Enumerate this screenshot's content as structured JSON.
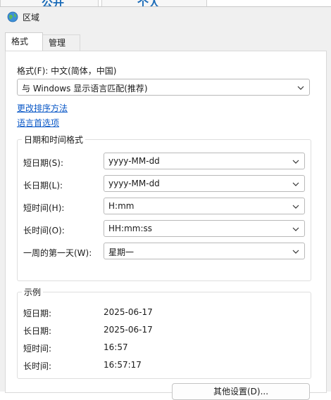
{
  "background": {
    "text_left": "公开",
    "text_right": "个人"
  },
  "window": {
    "title": "区域",
    "icon": "globe-icon"
  },
  "tabs": [
    {
      "label": "格式",
      "active": true
    },
    {
      "label": "管理",
      "active": false
    }
  ],
  "format": {
    "label": "格式(F): 中文(简体，中国)",
    "selected": "与 Windows 显示语言匹配(推荐)"
  },
  "links": {
    "sort": "更改排序方法",
    "language_prefs": "语言首选项"
  },
  "datetime_group": {
    "title": "日期和时间格式",
    "rows": [
      {
        "label": "短日期(S):",
        "value": "yyyy-MM-dd"
      },
      {
        "label": "长日期(L):",
        "value": "yyyy-MM-dd"
      },
      {
        "label": "短时间(H):",
        "value": "H:mm"
      },
      {
        "label": "长时间(O):",
        "value": "HH:mm:ss"
      },
      {
        "label": "一周的第一天(W):",
        "value": "星期一"
      }
    ]
  },
  "examples_group": {
    "title": "示例",
    "rows": [
      {
        "label": "短日期:",
        "value": "2025-06-17"
      },
      {
        "label": "长日期:",
        "value": "2025-06-17"
      },
      {
        "label": "短时间:",
        "value": "16:57"
      },
      {
        "label": "长时间:",
        "value": "16:57:17"
      }
    ]
  },
  "buttons": {
    "other_settings": "其他设置(D)..."
  },
  "colors": {
    "link": "#0a58c7",
    "window_bg": "#f0f0f0",
    "panel_bg": "#ffffff"
  }
}
